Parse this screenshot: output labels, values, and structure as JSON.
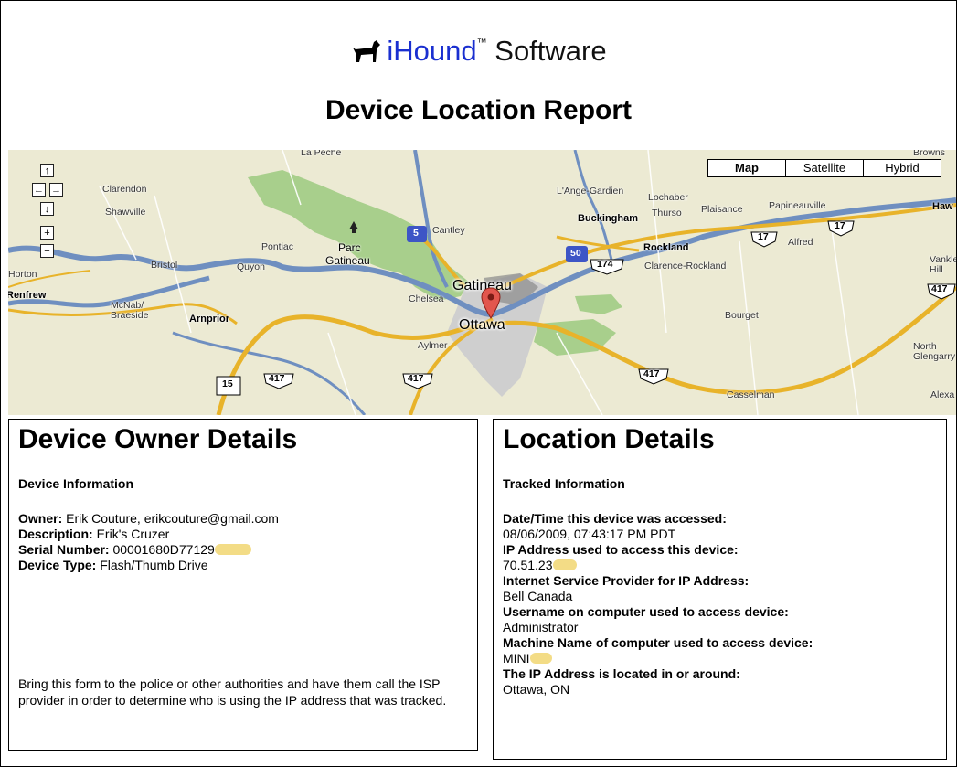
{
  "header": {
    "brand_name": "iHound",
    "brand_tm": "™",
    "brand_suffix": "Software",
    "logo_icon": "dog-icon",
    "title": "Device Location Report"
  },
  "map": {
    "type_buttons": [
      "Map",
      "Satellite",
      "Hybrid"
    ],
    "selected_type": "Map",
    "nav_controls": {
      "up": "↑",
      "left": "←",
      "right": "→",
      "down": "↓",
      "zoom_in": "+",
      "zoom_out": "−"
    },
    "labels": {
      "la_peche": "La Peche",
      "browns": "Browns",
      "clarendon": "Clarendon",
      "shawville": "Shawville",
      "pontiac": "Pontiac",
      "bristol": "Bristol",
      "quyon": "Quyon",
      "horton": "Horton",
      "renfrew": "Renfrew",
      "mcnab": "McNab/\nBraeside",
      "arnprior": "Arnprior",
      "parc": "Parc",
      "gatineau_park": "Gatineau",
      "cantley": "Cantley",
      "chelsea": "Chelsea",
      "gatineau": "Gatineau",
      "ottawa": "Ottawa",
      "aylmer": "Aylmer",
      "lange_gardien": "L'Ange-Gardien",
      "lochaber": "Lochaber",
      "buckingham": "Buckingham",
      "thurso": "Thurso",
      "plaisance": "Plaisance",
      "papineauville": "Papineauville",
      "haw": "Haw",
      "alfred": "Alfred",
      "rockland": "Rockland",
      "clarence_rockland": "Clarence-Rockland",
      "vankleek_hill": "Vankle\nHill",
      "bourget": "Bourget",
      "north_glengarry": "North\nGlengarry",
      "casselman": "Casselman",
      "alexa": "Alexa"
    },
    "shields": {
      "hwy5": "5",
      "hwy50": "50",
      "hwy174": "174",
      "hwy17a": "17",
      "hwy17b": "17",
      "hwy417a": "417",
      "hwy417b": "417",
      "hwy417c": "417",
      "hwy417d": "417",
      "hwy15": "15"
    },
    "marker_icon": "map-pin-icon"
  },
  "owner": {
    "heading": "Device Owner Details",
    "subheading": "Device Information",
    "fields": [
      {
        "label": "Owner:",
        "value": "Erik Couture, erikcouture@gmail.com"
      },
      {
        "label": "Description:",
        "value": "Erik's Cruzer"
      },
      {
        "label": "Serial Number:",
        "value": "00001680D77129"
      },
      {
        "label": "Device Type:",
        "value": "Flash/Thumb Drive"
      }
    ],
    "note": "Bring this form to the police or other authorities and have them call the ISP provider in order to determine who is using the IP address that was tracked."
  },
  "location": {
    "heading": "Location Details",
    "subheading": "Tracked Information",
    "fields": [
      {
        "label": "Date/Time this device was accessed:",
        "value": "08/06/2009, 07:43:17 PM PDT"
      },
      {
        "label": "IP Address used to access this device:",
        "value": "70.51.23"
      },
      {
        "label": "Internet Service Provider for IP Address:",
        "value": "Bell Canada"
      },
      {
        "label": "Username on computer used to access device:",
        "value": "Administrator"
      },
      {
        "label": "Machine Name of computer used to access device:",
        "value": "MINI"
      },
      {
        "label": "The IP Address is located in or around:",
        "value": "Ottawa, ON"
      }
    ]
  }
}
